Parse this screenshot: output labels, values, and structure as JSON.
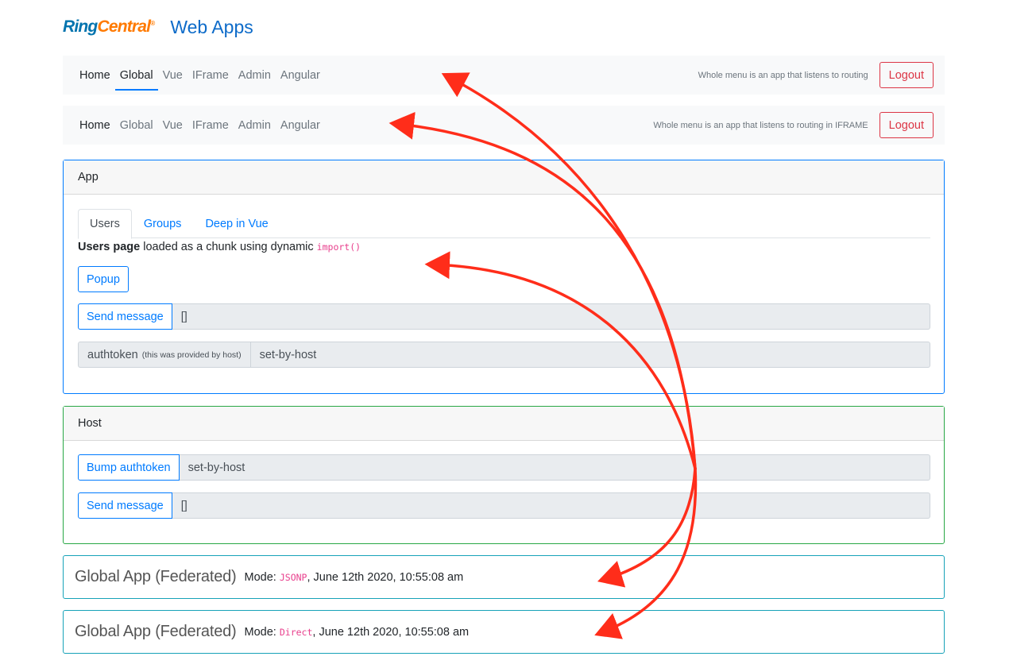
{
  "header": {
    "logo_ring": "Ring",
    "logo_central": "Central",
    "logo_reg": "®",
    "title": "Web Apps"
  },
  "navbar_top": {
    "items": [
      "Home",
      "Global",
      "Vue",
      "IFrame",
      "Admin",
      "Angular"
    ],
    "note": "Whole menu is an app that listens to routing",
    "logout_label": "Logout"
  },
  "navbar_iframe": {
    "items": [
      "Home",
      "Global",
      "Vue",
      "IFrame",
      "Admin",
      "Angular"
    ],
    "note": "Whole menu is an app that listens to routing in IFRAME",
    "logout_label": "Logout"
  },
  "app_card": {
    "header": "App",
    "tabs": [
      "Users",
      "Groups",
      "Deep in Vue"
    ],
    "users_bold": "Users page",
    "users_text": " loaded as a chunk using dynamic ",
    "users_code": "import()",
    "popup_label": "Popup",
    "send_label": "Send message",
    "send_value": "[]",
    "authtoken_label": "authtoken",
    "authtoken_note": "(this was provided by host)",
    "authtoken_value": "set-by-host"
  },
  "host_card": {
    "header": "Host",
    "bump_label": "Bump authtoken",
    "bump_value": "set-by-host",
    "send_label": "Send message",
    "send_value": "[]"
  },
  "federated": [
    {
      "title": "Global App (Federated)",
      "mode_label": "Mode: ",
      "mode": "JSONP",
      "time": ", June 12th 2020, 10:55:08 am"
    },
    {
      "title": "Global App (Federated)",
      "mode_label": "Mode: ",
      "mode": "Direct",
      "time": ", June 12th 2020, 10:55:08 am"
    }
  ],
  "colors": {
    "primary": "#007bff",
    "success": "#28a745",
    "info": "#17a2b8",
    "danger": "#dc3545",
    "annotation_arrow": "#ff2d1a"
  }
}
